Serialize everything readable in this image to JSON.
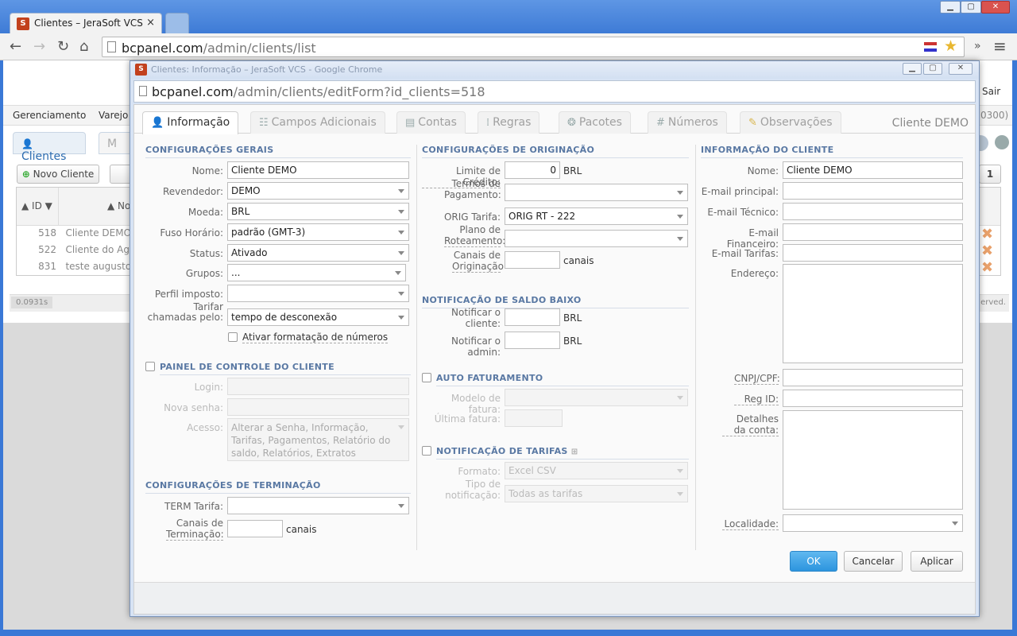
{
  "browser": {
    "tab_title": "Clientes – JeraSoft VCS",
    "tab_close": "×",
    "url_host": "bcpanel.com",
    "url_path": "/admin/clients/list",
    "win_min": "▁",
    "win_max": "▢",
    "win_close": "✕",
    "more": "»",
    "menu": "≡"
  },
  "page": {
    "nav_items": [
      "Gerenciamento",
      "Varejo"
    ],
    "logout": "Sair",
    "phone_suffix": "0300)",
    "tab_clientes": "Clientes",
    "tab_m": "M",
    "new_client": "Novo Cliente",
    "col_id": "ID",
    "col_name": "No",
    "pager": "1",
    "rows": [
      {
        "id": "518",
        "name": "Cliente DEMO"
      },
      {
        "id": "522",
        "name": "Cliente do Agen"
      },
      {
        "id": "831",
        "name": "teste augusto"
      }
    ],
    "timing": "0.0931s",
    "rights": "erved."
  },
  "modal": {
    "title": "Clientes: Informação – JeraSoft VCS - Google Chrome",
    "url_host": "bcpanel.com",
    "url_path": "/admin/clients/editForm?id_clients=518",
    "tabs": [
      "Informação",
      "Campos Adicionais",
      "Contas",
      "Regras",
      "Pacotes",
      "Números",
      "Observações"
    ],
    "client_name": "Cliente DEMO",
    "general": {
      "section": "CONFIGURAÇÕES GERAIS",
      "name_label": "Nome:",
      "name_value": "Cliente DEMO",
      "reseller_label": "Revendedor:",
      "reseller_value": "DEMO",
      "currency_label": "Moeda:",
      "currency_value": "BRL",
      "tz_label": "Fuso Horário:",
      "tz_value": "padrão (GMT-3)",
      "status_label": "Status:",
      "status_value": "Ativado",
      "groups_label": "Grupos:",
      "groups_value": "...",
      "tax_label": "Perfil imposto:",
      "tax_value": "",
      "billing_label": "Tarifar chamadas pelo:",
      "billing_value": "tempo de desconexão",
      "format_numbers": "Ativar formatação de números"
    },
    "panel": {
      "section": "PAINEL DE CONTROLE DO CLIENTE",
      "login_label": "Login:",
      "password_label": "Nova senha:",
      "access_label": "Acesso:",
      "access_value": "Alterar a Senha, Informação, Tarifas, Pagamentos, Relatório do saldo, Relatórios, Extratos"
    },
    "termination": {
      "section": "CONFIGURAÇÕES DE TERMINAÇÃO",
      "tariff_label": "TERM Tarifa:",
      "channels_label": "Canais de Terminação:",
      "channels_unit": "canais"
    },
    "origination": {
      "section": "CONFIGURAÇÕES DE ORIGINAÇÃO",
      "credit_label": "Limite de Crédito:",
      "credit_value": "0",
      "credit_unit": "BRL",
      "terms_label": "Termos de Pagamento:",
      "tariff_label": "ORIG Tarifa:",
      "tariff_value": "ORIG RT - 222",
      "routing_label": "Plano de Roteamento:",
      "channels_label": "Canais de Originação",
      "channels_unit": "canais"
    },
    "low_balance": {
      "section": "NOTIFICAÇÃO DE SALDO BAIXO",
      "notify_client_label": "Notificar o cliente:",
      "notify_admin_label": "Notificar o admin:",
      "unit": "BRL"
    },
    "auto_billing": {
      "section": "AUTO FATURAMENTO",
      "template_label": "Modelo de fatura:",
      "last_label": "Última fatura:"
    },
    "rate_notice": {
      "section": "NOTIFICAÇÃO DE TARIFAS",
      "format_label": "Formato:",
      "format_value": "Excel CSV",
      "type_label": "Tipo de notificação:",
      "type_value": "Todas as tarifas"
    },
    "client_info": {
      "section": "INFORMAÇÃO DO CLIENTE",
      "name_label": "Nome:",
      "name_value": "Cliente DEMO",
      "email_main": "E-mail principal:",
      "email_tech": "E-mail Técnico:",
      "email_fin": "E-mail Financeiro:",
      "email_rates": "E-mail Tarifas:",
      "address": "Endereço:",
      "cnpj": "CNPJ/CPF:",
      "reg_id": "Reg ID:",
      "account_details": "Detalhes da conta:",
      "locality": "Localidade:"
    },
    "buttons": {
      "ok": "OK",
      "cancel": "Cancelar",
      "apply": "Aplicar"
    }
  }
}
